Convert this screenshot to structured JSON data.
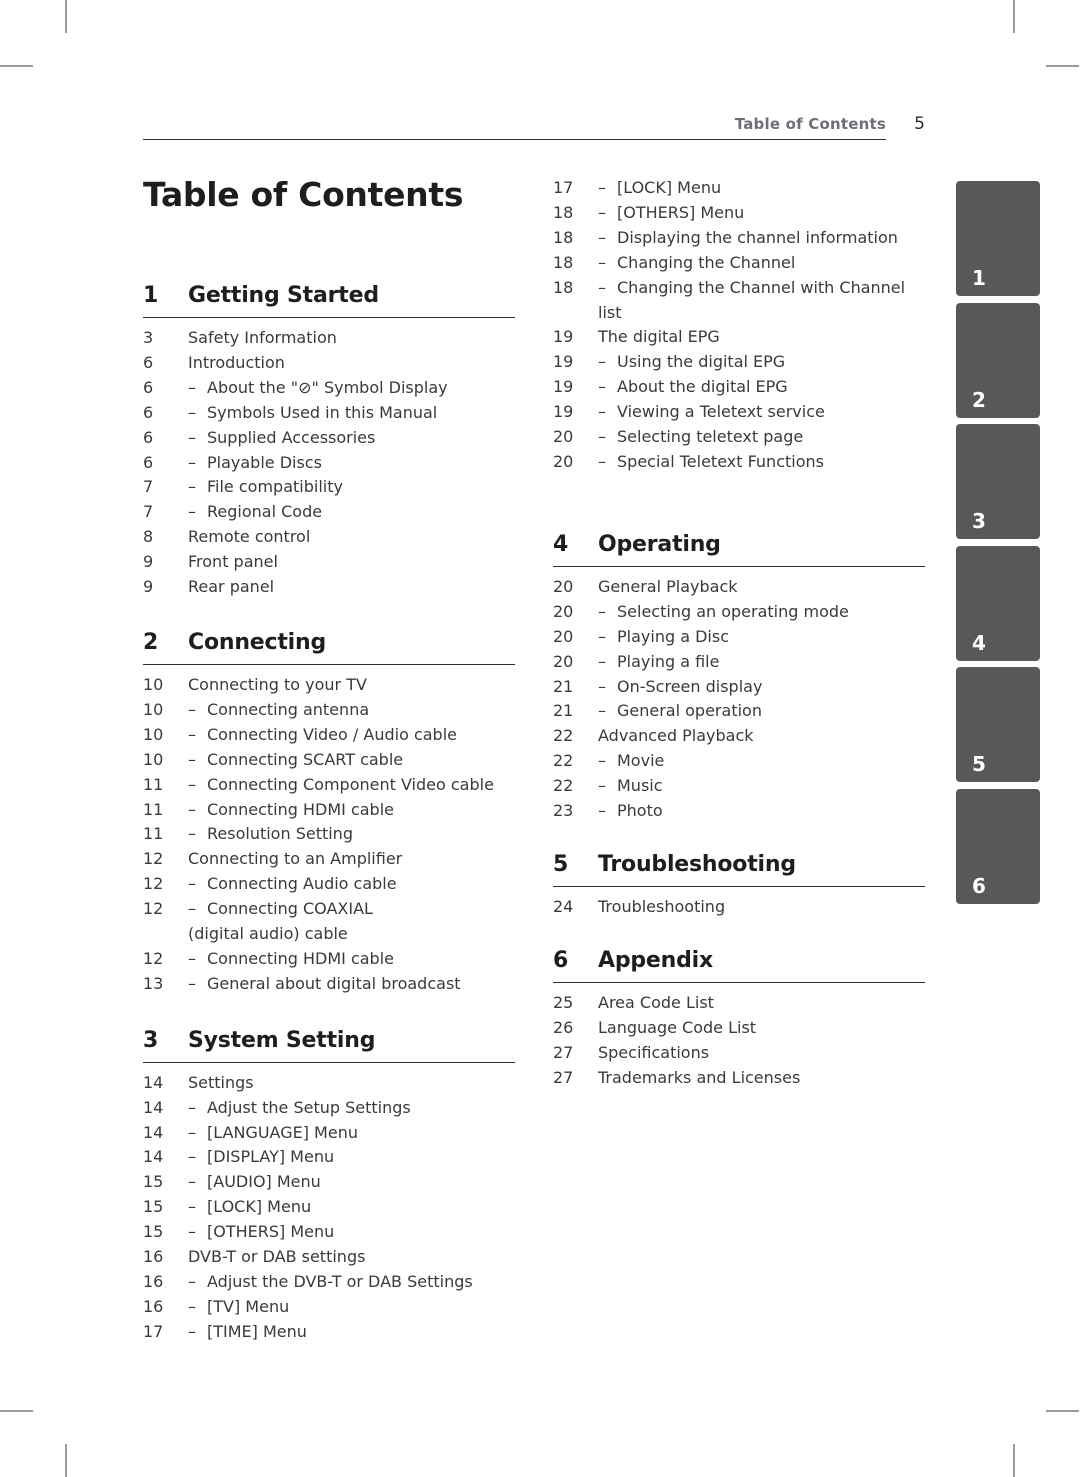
{
  "running_header": {
    "title": "Table of Contents",
    "page_number": "5"
  },
  "page_title": "Table of Contents",
  "sections": [
    {
      "number": "1",
      "title": "Getting Started",
      "entries": [
        {
          "page": "3",
          "text": "Safety Information",
          "sub": false
        },
        {
          "page": "6",
          "text": "Introduction",
          "sub": false
        },
        {
          "page": "6",
          "text": "About the \"⊘\" Symbol Display",
          "sub": true
        },
        {
          "page": "6",
          "text": "Symbols Used in this Manual",
          "sub": true
        },
        {
          "page": "6",
          "text": "Supplied Accessories",
          "sub": true
        },
        {
          "page": "6",
          "text": "Playable Discs",
          "sub": true
        },
        {
          "page": "7",
          "text": "File compatibility",
          "sub": true
        },
        {
          "page": "7",
          "text": "Regional Code",
          "sub": true
        },
        {
          "page": "8",
          "text": "Remote control",
          "sub": false
        },
        {
          "page": "9",
          "text": "Front panel",
          "sub": false
        },
        {
          "page": "9",
          "text": "Rear panel",
          "sub": false
        }
      ]
    },
    {
      "number": "2",
      "title": "Connecting",
      "entries": [
        {
          "page": "10",
          "text": "Connecting to your TV",
          "sub": false
        },
        {
          "page": "10",
          "text": "Connecting antenna",
          "sub": true
        },
        {
          "page": "10",
          "text": "Connecting Video / Audio cable",
          "sub": true
        },
        {
          "page": "10",
          "text": "Connecting SCART cable",
          "sub": true
        },
        {
          "page": "11",
          "text": "Connecting Component Video cable",
          "sub": true
        },
        {
          "page": "11",
          "text": "Connecting HDMI cable",
          "sub": true
        },
        {
          "page": "11",
          "text": "Resolution Setting",
          "sub": true
        },
        {
          "page": "12",
          "text": "Connecting to an Amplifier",
          "sub": false
        },
        {
          "page": "12",
          "text": "Connecting Audio cable",
          "sub": true
        },
        {
          "page": "12",
          "text": "Connecting COAXIAL",
          "continuation": "(digital audio) cable",
          "sub": true
        },
        {
          "page": "12",
          "text": "Connecting HDMI cable",
          "sub": true
        },
        {
          "page": "13",
          "text": "General about digital broadcast",
          "sub": true
        }
      ]
    },
    {
      "number": "3",
      "title": "System Setting",
      "entries": [
        {
          "page": "14",
          "text": "Settings",
          "sub": false
        },
        {
          "page": "14",
          "text": "Adjust the Setup Settings",
          "sub": true
        },
        {
          "page": "14",
          "text": "[LANGUAGE] Menu",
          "sub": true
        },
        {
          "page": "14",
          "text": "[DISPLAY] Menu",
          "sub": true
        },
        {
          "page": "15",
          "text": "[AUDIO] Menu",
          "sub": true
        },
        {
          "page": "15",
          "text": "[LOCK] Menu",
          "sub": true
        },
        {
          "page": "15",
          "text": "[OTHERS] Menu",
          "sub": true
        },
        {
          "page": "16",
          "text": "DVB-T or DAB settings",
          "sub": false
        },
        {
          "page": "16",
          "text": "Adjust the DVB-T or DAB Settings",
          "sub": true
        },
        {
          "page": "16",
          "text": "[TV] Menu",
          "sub": true
        },
        {
          "page": "17",
          "text": "[TIME] Menu",
          "sub": true
        }
      ]
    },
    {
      "number": "",
      "title": "",
      "continued": true,
      "entries": [
        {
          "page": "17",
          "text": "[LOCK] Menu",
          "sub": true
        },
        {
          "page": "18",
          "text": "[OTHERS] Menu",
          "sub": true
        },
        {
          "page": "18",
          "text": "Displaying the channel information",
          "sub": true
        },
        {
          "page": "18",
          "text": "Changing the Channel",
          "sub": true
        },
        {
          "page": "18",
          "text": "Changing the Channel with Channel",
          "continuation": "list",
          "sub": true
        },
        {
          "page": "19",
          "text": "The digital EPG",
          "sub": false
        },
        {
          "page": "19",
          "text": "Using the digital EPG",
          "sub": true
        },
        {
          "page": "19",
          "text": "About the digital EPG",
          "sub": true
        },
        {
          "page": "19",
          "text": "Viewing a Teletext service",
          "sub": true
        },
        {
          "page": "20",
          "text": "Selecting teletext page",
          "sub": true
        },
        {
          "page": "20",
          "text": "Special Teletext Functions",
          "sub": true
        }
      ]
    },
    {
      "number": "4",
      "title": "Operating",
      "entries": [
        {
          "page": "20",
          "text": "General Playback",
          "sub": false
        },
        {
          "page": "20",
          "text": "Selecting an operating mode",
          "sub": true
        },
        {
          "page": "20",
          "text": "Playing a Disc",
          "sub": true
        },
        {
          "page": "20",
          "text": "Playing a file",
          "sub": true
        },
        {
          "page": "21",
          "text": "On-Screen display",
          "sub": true
        },
        {
          "page": "21",
          "text": "General operation",
          "sub": true
        },
        {
          "page": "22",
          "text": "Advanced Playback",
          "sub": false
        },
        {
          "page": "22",
          "text": "Movie",
          "sub": true
        },
        {
          "page": "22",
          "text": "Music",
          "sub": true
        },
        {
          "page": "23",
          "text": "Photo",
          "sub": true
        }
      ]
    },
    {
      "number": "5",
      "title": "Troubleshooting",
      "entries": [
        {
          "page": "24",
          "text": "Troubleshooting",
          "sub": false
        }
      ]
    },
    {
      "number": "6",
      "title": "Appendix",
      "entries": [
        {
          "page": "25",
          "text": "Area Code List",
          "sub": false
        },
        {
          "page": "26",
          "text": "Language Code List",
          "sub": false
        },
        {
          "page": "27",
          "text": "Specifications",
          "sub": false
        },
        {
          "page": "27",
          "text": "Trademarks and Licenses",
          "sub": false
        }
      ]
    }
  ],
  "dash": "–",
  "chapter_tabs": [
    "1",
    "2",
    "3",
    "4",
    "5",
    "6"
  ],
  "colors": {
    "tab": "#58585a",
    "running_header": "#6e6e76",
    "text": "#3a3a3c",
    "heading": "#1e1e1e"
  }
}
